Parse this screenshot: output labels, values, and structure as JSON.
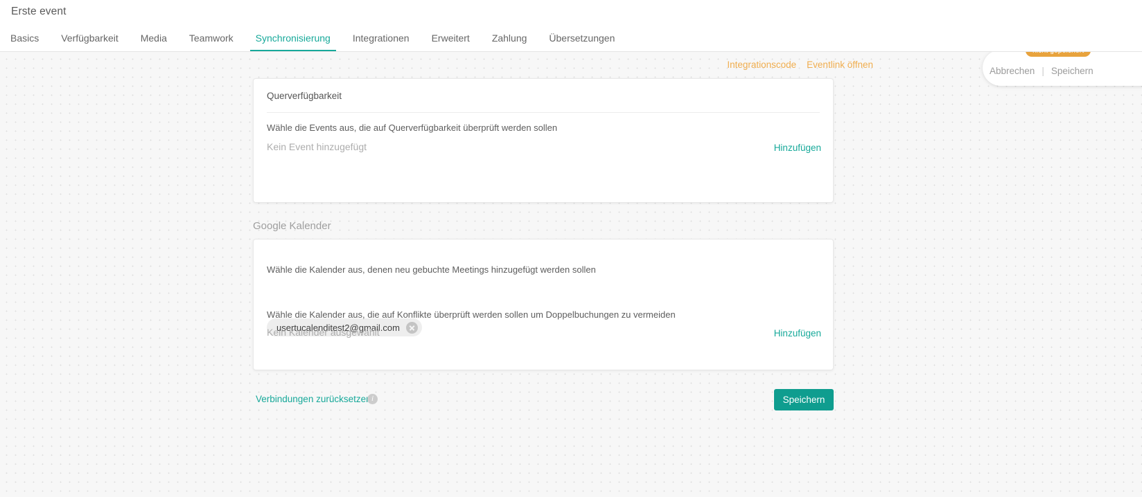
{
  "header": {
    "title": "Erste event",
    "tabs": [
      {
        "label": "Basics",
        "active": false
      },
      {
        "label": "Verfügbarkeit",
        "active": false
      },
      {
        "label": "Media",
        "active": false
      },
      {
        "label": "Teamwork",
        "active": false
      },
      {
        "label": "Synchronisierung",
        "active": true
      },
      {
        "label": "Integrationen",
        "active": false
      },
      {
        "label": "Erweitert",
        "active": false
      },
      {
        "label": "Zahlung",
        "active": false
      },
      {
        "label": "Übersetzungen",
        "active": false
      }
    ]
  },
  "quicklinks": [
    {
      "label": "Integrationscode"
    },
    {
      "label": "Eventlink öffnen"
    }
  ],
  "cross_availability_card": {
    "heading": "Querverfügbarkeit",
    "description": "Wähle die Events aus, die auf Querverfügbarkeit überprüft werden sollen",
    "empty_text": "Kein Event hinzugefügt",
    "add_label": "Hinzufügen"
  },
  "google_calendar": {
    "section_label": "Google Kalender",
    "add_description": "Wähle die Kalender aus, denen neu gebuchte Meetings hinzugefügt werden sollen",
    "selected_calendars": [
      {
        "email": "usertucalenditest2@gmail.com"
      }
    ],
    "conflict_description": "Wähle die Kalender aus, die auf Konflikte überprüft werden sollen um Doppelbuchungen zu vermeiden",
    "empty_text": "Kein Kalender ausgewählt",
    "add_label": "Hinzufügen"
  },
  "footer": {
    "reset_label": "Verbindungen zurücksetzen",
    "info_icon": "info-icon",
    "save_label": "Speichern"
  },
  "unsaved_panel": {
    "badge": "nicht gepeichert",
    "cancel_label": "Abbrechen",
    "separator": "|",
    "save_label": "Speichern"
  },
  "colors": {
    "accent_teal": "#17a99a",
    "button_teal": "#0f9d8f",
    "link_orange": "#f0ad4e",
    "badge_orange": "#e8a33d",
    "canvas": "#f7f7f7"
  }
}
